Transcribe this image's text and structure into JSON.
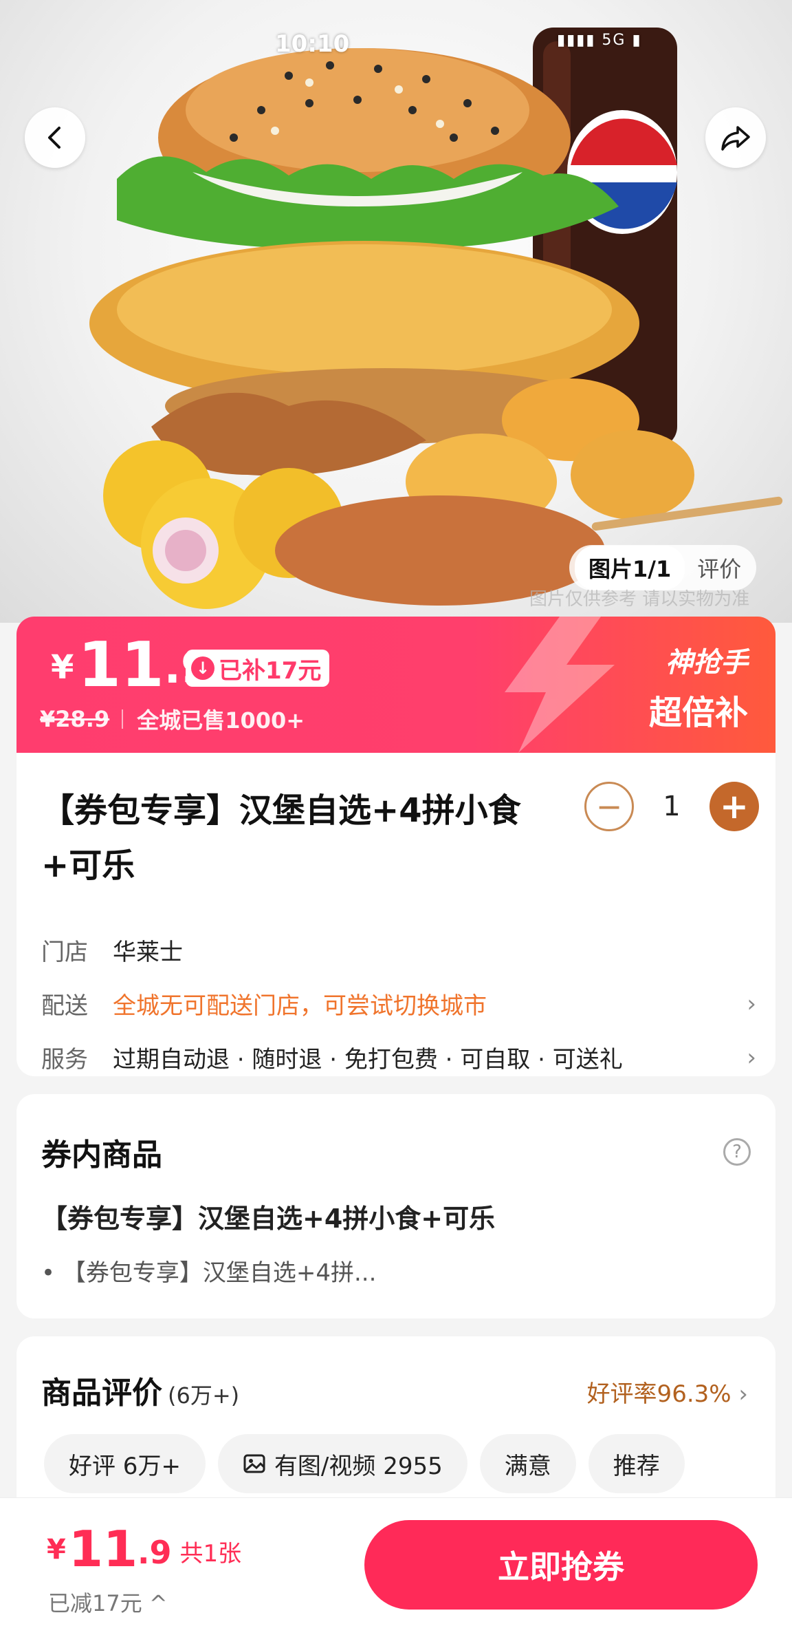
{
  "status_bar": {
    "time": "10:10",
    "icons": "5G"
  },
  "hero": {
    "photo_tab_active": "图片1/1",
    "photo_tab_reviews": "评价",
    "watermark": "图片仅供参考 请以实物为准"
  },
  "price_banner": {
    "currency": "¥",
    "price_int": "11",
    "price_dec": ".9",
    "subsidy": "已补17元",
    "original_price": "¥28.9",
    "sold": "全城已售1000+",
    "promo_title": "神抢手",
    "promo_sub": "超倍补"
  },
  "product": {
    "title": "【券包专享】汉堡自选+4拼小食+可乐",
    "quantity": "1",
    "store_label": "门店",
    "store_value": "华莱士",
    "delivery_label": "配送",
    "delivery_value": "全城无可配送门店，可尝试切换城市",
    "service_label": "服务",
    "service_value": "过期自动退 · 随时退 · 免打包费 · 可自取 · 可送礼"
  },
  "coupon": {
    "section_title": "券内商品",
    "item_title": "【券包专享】汉堡自选+4拼小食+可乐",
    "item_sub": "• 【券包专享】汉堡自选+4拼..."
  },
  "reviews": {
    "title": "商品评价",
    "count": "(6万+)",
    "rate": "好评率96.3%",
    "chips": [
      "好评 6万+",
      "有图/视频 2955",
      "满意",
      "推荐"
    ]
  },
  "bottom_bar": {
    "currency": "¥",
    "price_int": "11",
    "price_dec": ".9",
    "count": "共1张",
    "saved": "已减17元",
    "buy_label": "立即抢券"
  },
  "colors": {
    "accent_pink": "#ff2a58",
    "accent_orange": "#c4682b",
    "delivery_orange": "#f0742c"
  }
}
